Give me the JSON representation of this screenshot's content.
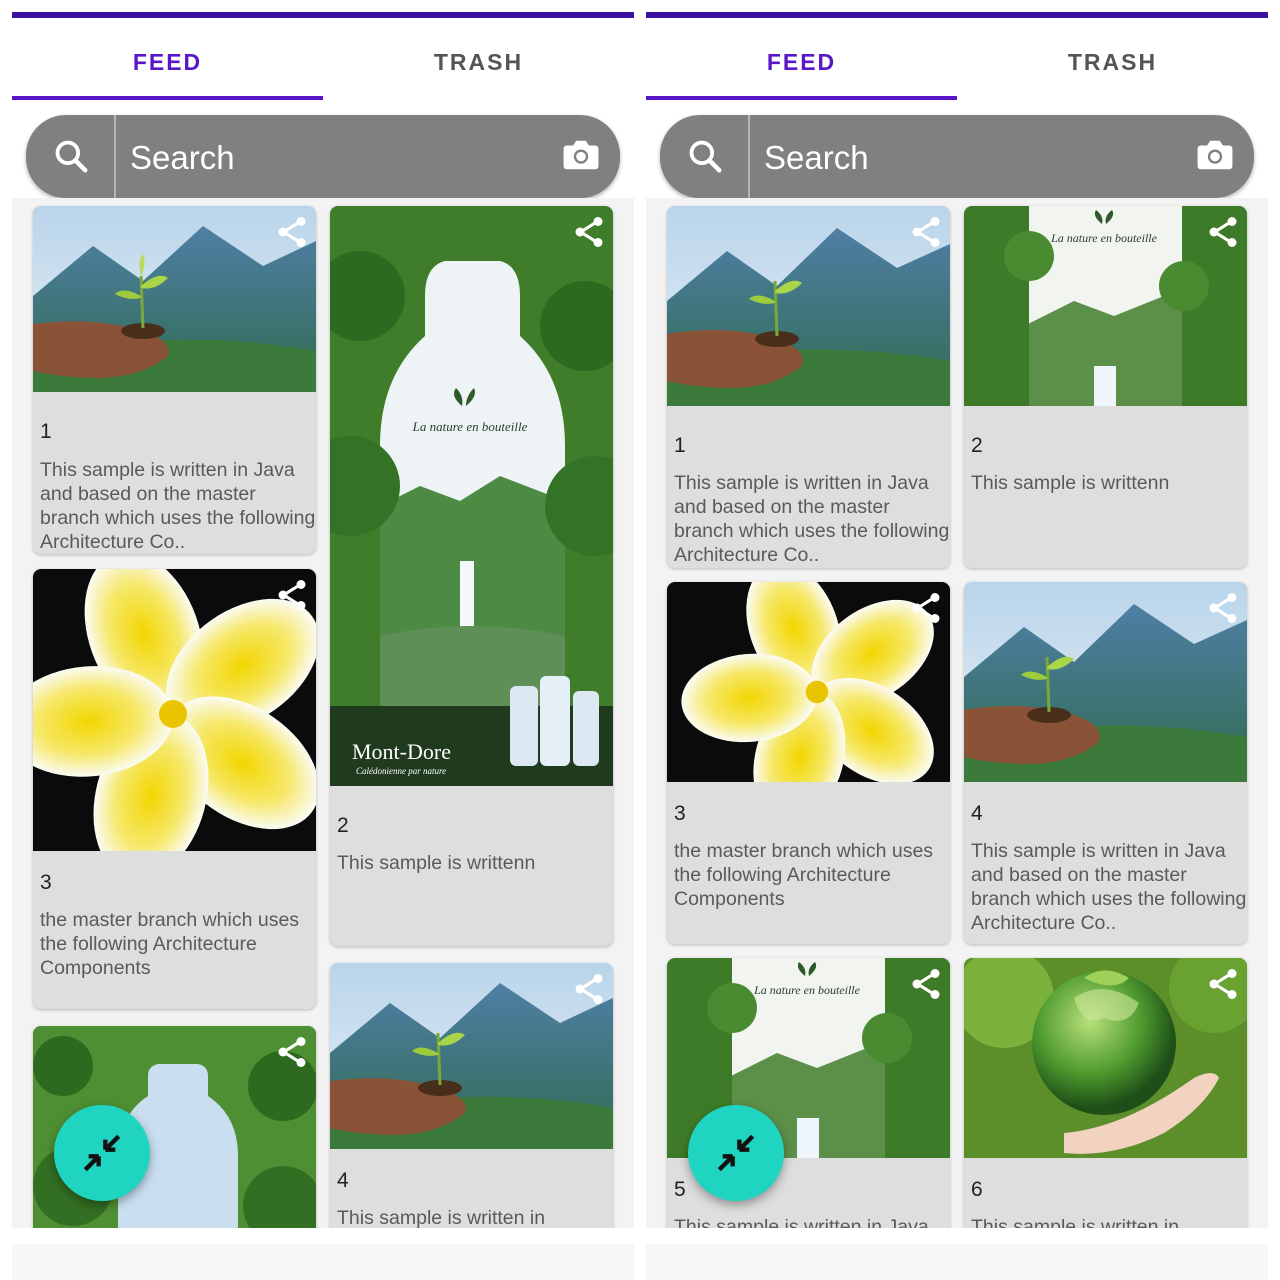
{
  "tabs": [
    "FEED",
    "TRASH"
  ],
  "search": {
    "placeholder": "Search"
  },
  "colors": {
    "accent": "#5a16c9",
    "fab": "#1fd4c0",
    "searchbar": "#808080",
    "card": "#dedede"
  },
  "left": {
    "cards": [
      {
        "number": "1",
        "text": "This sample is written in Java and based on the master branch which uses the following Architecture Co..",
        "image": "seedling-in-hands"
      },
      {
        "number": "2",
        "text": "This sample is writtenn",
        "image": "mont-dore-bottle-ad",
        "ad_title": "La nature en bouteille",
        "brand": "Mont-Dore",
        "tagline": "Calédonienne par nature"
      },
      {
        "number": "3",
        "text": "the master branch which uses the following Architecture Components",
        "image": "frangipani-flower"
      },
      {
        "number": "4",
        "text": "This sample is written in",
        "image": "seedling-in-hands"
      },
      {
        "number": "",
        "text": "",
        "image": "mont-dore-bottle-ad"
      }
    ]
  },
  "right": {
    "cards": [
      {
        "number": "1",
        "text": "This sample is written in Java and based on the master branch which uses the following Architecture Co..",
        "image": "seedling-in-hands"
      },
      {
        "number": "2",
        "text": "This sample is writtenn",
        "image": "waterfall-frame",
        "ad_title": "La nature en bouteille"
      },
      {
        "number": "3",
        "text": "the master branch which uses the following Architecture Components",
        "image": "frangipani-flower"
      },
      {
        "number": "4",
        "text": "This sample is written in Java and based on the master branch which uses the following Architecture Co..",
        "image": "seedling-in-hands"
      },
      {
        "number": "5",
        "text": "This sample is written in Java",
        "image": "waterfall-frame",
        "ad_title": "La nature en bouteille"
      },
      {
        "number": "6",
        "text": "This sample is written in",
        "image": "globe-in-hand"
      }
    ]
  }
}
